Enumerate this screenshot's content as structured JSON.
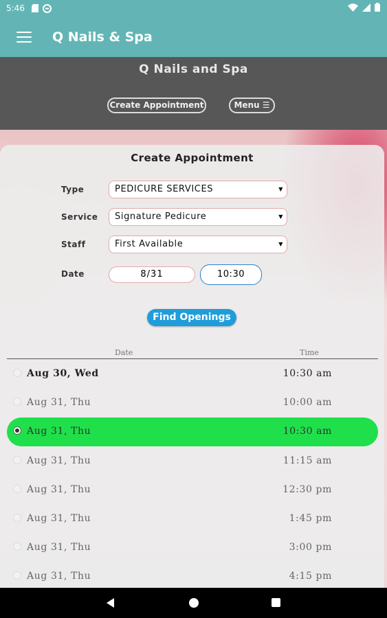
{
  "status_bar": {
    "time": "5:46"
  },
  "app_bar": {
    "title": "Q Nails & Spa"
  },
  "web_header": {
    "title": "Q Nails and Spa",
    "create_appointment_label": "Create Appointment",
    "menu_label": "Menu ☰"
  },
  "form": {
    "title": "Create Appointment",
    "type_label": "Type",
    "type_value": "PEDICURE SERVICES",
    "service_label": "Service",
    "service_value": "Signature Pedicure",
    "staff_label": "Staff",
    "staff_value": "First Available",
    "date_label": "Date",
    "date_value": "8/31",
    "time_value": "10:30",
    "find_button": "Find Openings"
  },
  "openings": {
    "date_header": "Date",
    "time_header": "Time",
    "rows": [
      {
        "date": "Aug 30, Wed",
        "time": "10:30 am"
      },
      {
        "date": "Aug 31, Thu",
        "time": "10:00 am"
      },
      {
        "date": "Aug 31, Thu",
        "time": "10:30 am"
      },
      {
        "date": "Aug 31, Thu",
        "time": "11:15 am"
      },
      {
        "date": "Aug 31, Thu",
        "time": "12:30 pm"
      },
      {
        "date": "Aug 31, Thu",
        "time": "1:45 pm"
      },
      {
        "date": "Aug 31, Thu",
        "time": "3:00 pm"
      },
      {
        "date": "Aug 31, Thu",
        "time": "4:15 pm"
      }
    ],
    "selected_index": 2
  },
  "colors": {
    "teal": "#63b5b5",
    "header_gray": "#575757",
    "button_blue": "#1f9ddb",
    "selected_green": "#1fe04a"
  }
}
